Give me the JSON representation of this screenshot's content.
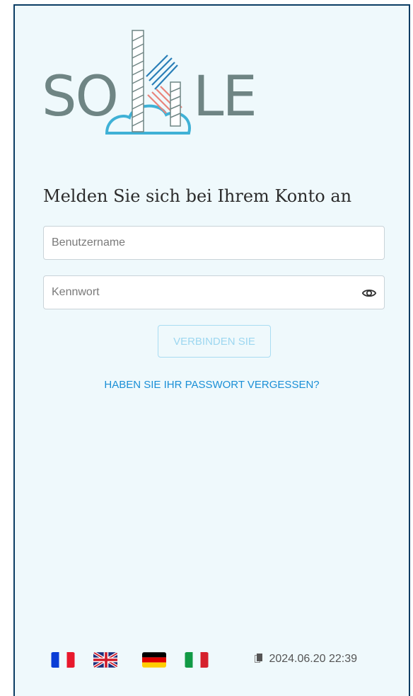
{
  "brand": {
    "wordmark_left": "SO",
    "wordmark_right": "LE",
    "colors": {
      "gray": "#6f8584",
      "teal": "#3fb1d6",
      "blue": "#2a7fb8",
      "salmon": "#e9847b"
    }
  },
  "login": {
    "title": "Melden Sie sich bei Ihrem Konto an",
    "username_placeholder": "Benutzername",
    "password_placeholder": "Kennwort",
    "password_toggle_icon": "eye-icon",
    "connect_label": "VERBINDEN SIE",
    "forgot_label": "HABEN SIE IHR PASSWORT VERGESSEN?"
  },
  "footer": {
    "languages": [
      {
        "code": "fr",
        "icon": "french-flag-icon"
      },
      {
        "code": "en",
        "icon": "uk-flag-icon"
      },
      {
        "code": "de",
        "icon": "german-flag-icon"
      },
      {
        "code": "it",
        "icon": "italian-flag-icon"
      }
    ],
    "version_icon": "document-icon",
    "version": "2024.06.20 22:39"
  }
}
